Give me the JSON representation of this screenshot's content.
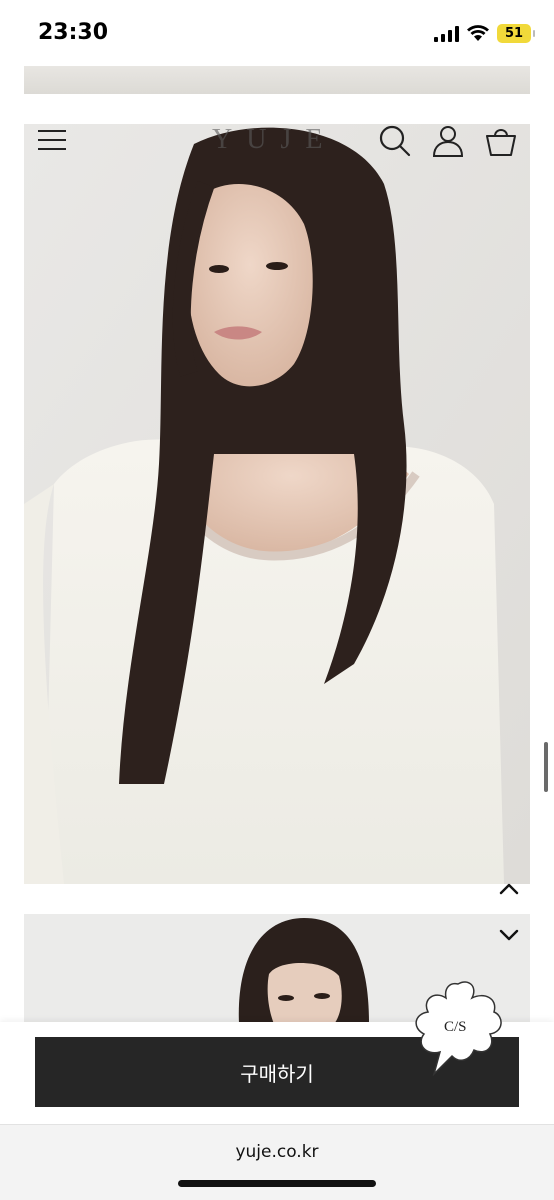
{
  "status_bar": {
    "time": "23:30",
    "battery": "51"
  },
  "header": {
    "brand": "YUJE"
  },
  "cta": {
    "buy_label": "구매하기",
    "cs_label": "C/S"
  },
  "browser": {
    "url": "yuje.co.kr"
  },
  "icons": [
    "menu-icon",
    "search-icon",
    "account-icon",
    "cart-icon",
    "chevron-up-icon",
    "chevron-down-icon",
    "signal-icon",
    "wifi-icon"
  ],
  "colors": {
    "buy_button": "#262626",
    "battery": "#f1d93a"
  }
}
